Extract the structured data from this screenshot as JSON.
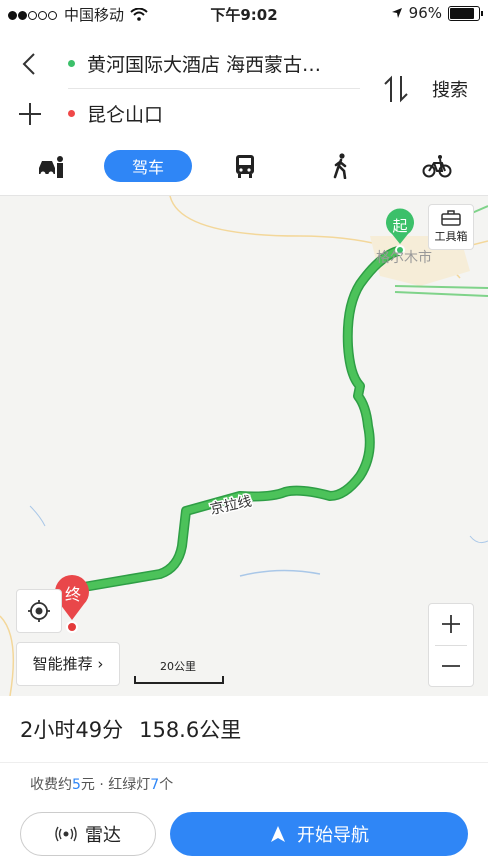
{
  "status_bar": {
    "carrier": "中国移动",
    "time": "下午9:02",
    "battery": "96%"
  },
  "route": {
    "start": "黄河国际大酒店 海西蒙古…",
    "end": "昆仑山口",
    "search_label": "搜索"
  },
  "modes": {
    "active_label": "驾车"
  },
  "map": {
    "start_marker": "起",
    "end_marker": "终",
    "city_label": "格尔木市",
    "road_label": "京拉线",
    "toolbox_label": "工具箱",
    "smart_recommend": "智能推荐",
    "scale_label": "20公里",
    "route_color": "#4cc25a"
  },
  "summary": {
    "duration": "2小时49分",
    "distance": "158.6公里",
    "fee_prefix": "收费约",
    "fee_value": "5",
    "fee_unit": "元",
    "separator": " · ",
    "lights_prefix": "红绿灯",
    "lights_value": "7",
    "lights_unit": "个",
    "radar_label": "雷达",
    "start_nav_label": "开始导航"
  }
}
